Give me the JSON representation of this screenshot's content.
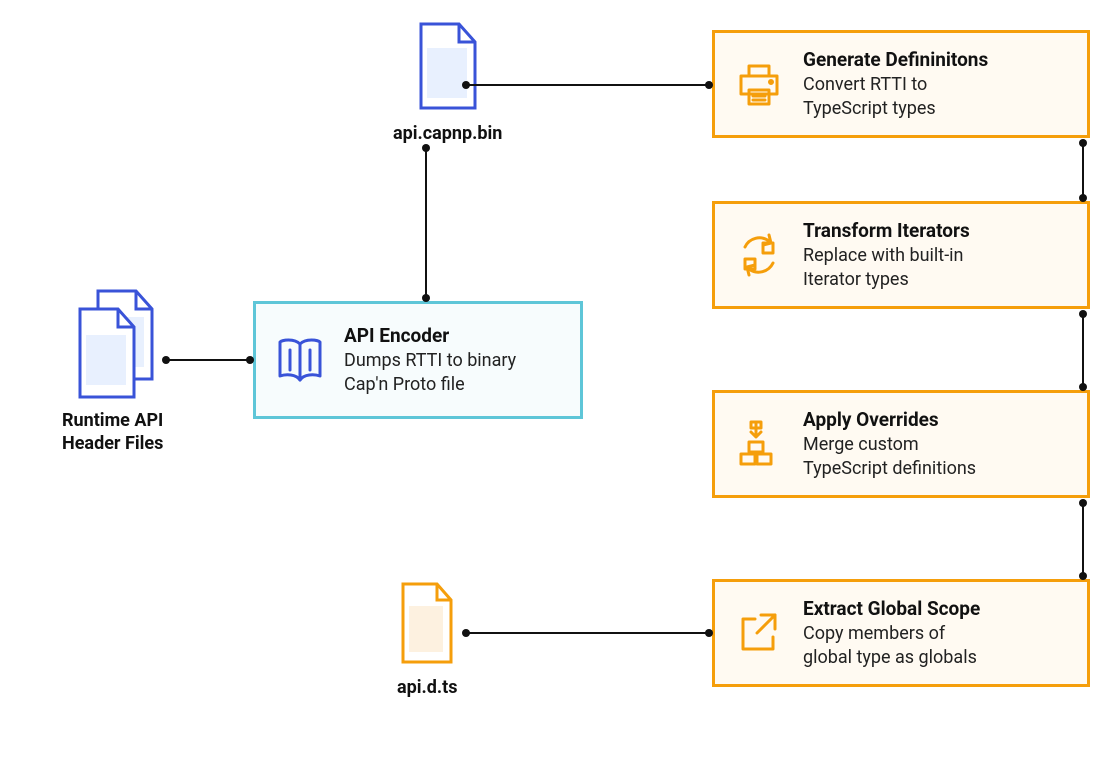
{
  "colors": {
    "blue": "#3953d8",
    "lightblue": "#e8f0fe",
    "cyan": "#5ec6d8",
    "orange": "#f59e0b",
    "lightorange": "#fdf1e0"
  },
  "nodes": {
    "runtime_api": {
      "label": "Runtime API\nHeader Files",
      "icon": "files-blue"
    },
    "capnp_bin": {
      "label": "api.capnp.bin",
      "icon": "file-blue"
    },
    "api_encoder": {
      "title": "API Encoder",
      "desc": "Dumps RTTI to binary\nCap'n Proto file",
      "icon": "book-blue"
    },
    "generate": {
      "title": "Generate Defininitons",
      "desc": "Convert RTTI to\nTypeScript types",
      "icon": "printer-orange"
    },
    "transform": {
      "title": "Transform Iterators",
      "desc": "Replace with built-in\nIterator types",
      "icon": "cycle-orange"
    },
    "overrides": {
      "title": "Apply Overrides",
      "desc": "Merge custom\nTypeScript definitions",
      "icon": "sort-orange"
    },
    "extract": {
      "title": "Extract Global Scope",
      "desc": "Copy members of\nglobal type as globals",
      "icon": "external-orange"
    },
    "api_d_ts": {
      "label": "api.d.ts",
      "icon": "file-orange"
    }
  }
}
